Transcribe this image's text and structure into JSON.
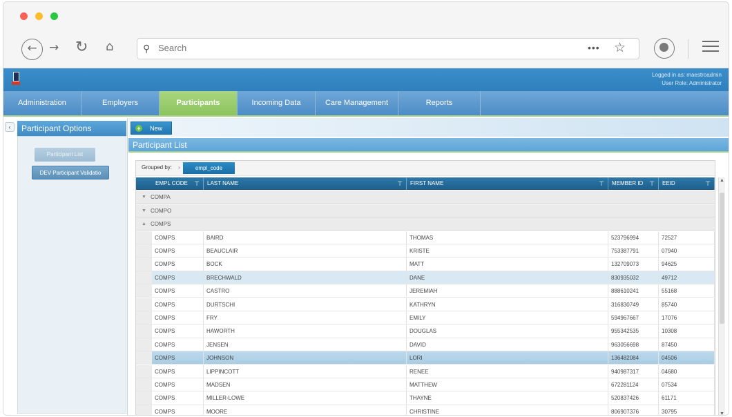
{
  "browser": {
    "search_placeholder": "Search",
    "more_label": "•••"
  },
  "header": {
    "logged_in": "Logged in as: maestroadmin",
    "user_role": "User Role: Administrator"
  },
  "nav": {
    "tabs": [
      {
        "label": "Administration",
        "active": false
      },
      {
        "label": "Employers",
        "active": false
      },
      {
        "label": "Participants",
        "active": true
      },
      {
        "label": "Incoming Data",
        "active": false
      },
      {
        "label": "Care Management",
        "active": false
      },
      {
        "label": "Reports",
        "active": false
      }
    ]
  },
  "options": {
    "title": "Participant Options",
    "buttons": [
      "Participant List",
      "DEV Participant Validatio"
    ]
  },
  "content": {
    "new_label": "New",
    "list_title": "Participant List",
    "grouped_by_label": "Grouped by:",
    "grouped_by_value": "empl_code"
  },
  "grid": {
    "columns": [
      "EMPL CODE",
      "LAST NAME",
      "FIRST NAME",
      "MEMBER ID",
      "EEID"
    ],
    "groups": [
      "COMPA",
      "COMPO",
      "COMPS"
    ],
    "rows": [
      {
        "code": "COMPS",
        "last": "BAIRD",
        "first": "THOMAS",
        "member": "523796994",
        "eeid": "72527"
      },
      {
        "code": "COMPS",
        "last": "BEAUCLAIR",
        "first": "KRISTE",
        "member": "753387791",
        "eeid": "07940"
      },
      {
        "code": "COMPS",
        "last": "BOCK",
        "first": "MATT",
        "member": "132709073",
        "eeid": "94625"
      },
      {
        "code": "COMPS",
        "last": "BRECHWALD",
        "first": "DANE",
        "member": "830935032",
        "eeid": "49712"
      },
      {
        "code": "COMPS",
        "last": "CASTRO",
        "first": "JEREMIAH",
        "member": "888610241",
        "eeid": "55168"
      },
      {
        "code": "COMPS",
        "last": "DURTSCHI",
        "first": "KATHRYN",
        "member": "316830749",
        "eeid": "85740"
      },
      {
        "code": "COMPS",
        "last": "FRY",
        "first": "EMILY",
        "member": "594967667",
        "eeid": "17076"
      },
      {
        "code": "COMPS",
        "last": "HAWORTH",
        "first": "DOUGLAS",
        "member": "955342535",
        "eeid": "10308"
      },
      {
        "code": "COMPS",
        "last": "JENSEN",
        "first": "DAVID",
        "member": "963056698",
        "eeid": "87450"
      },
      {
        "code": "COMPS",
        "last": "JOHNSON",
        "first": "LORI",
        "member": "136482084",
        "eeid": "04506"
      },
      {
        "code": "COMPS",
        "last": "LIPPINCOTT",
        "first": "RENEE",
        "member": "940987317",
        "eeid": "04680"
      },
      {
        "code": "COMPS",
        "last": "MADSEN",
        "first": "MATTHEW",
        "member": "672281124",
        "eeid": "07534"
      },
      {
        "code": "COMPS",
        "last": "MILLER-LOWE",
        "first": "THAYNE",
        "member": "520837426",
        "eeid": "61171"
      },
      {
        "code": "COMPS",
        "last": "MOORE",
        "first": "CHRISTINE",
        "member": "806907376",
        "eeid": "30795"
      }
    ],
    "highlighted_row": "BRECHWALD",
    "selected_row": "JOHNSON"
  }
}
